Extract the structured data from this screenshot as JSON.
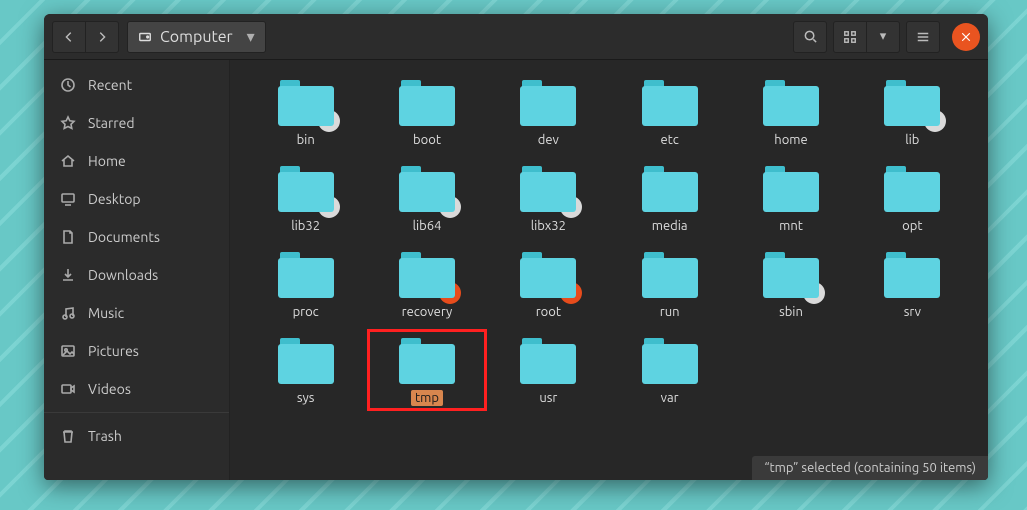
{
  "path": {
    "location": "Computer"
  },
  "sidebar": {
    "items": [
      {
        "label": "Recent",
        "icon": "clock-icon"
      },
      {
        "label": "Starred",
        "icon": "star-icon"
      },
      {
        "label": "Home",
        "icon": "home-icon"
      },
      {
        "label": "Desktop",
        "icon": "desktop-icon"
      },
      {
        "label": "Documents",
        "icon": "documents-icon"
      },
      {
        "label": "Downloads",
        "icon": "downloads-icon"
      },
      {
        "label": "Music",
        "icon": "music-icon"
      },
      {
        "label": "Pictures",
        "icon": "pictures-icon"
      },
      {
        "label": "Videos",
        "icon": "videos-icon"
      },
      {
        "label": "Trash",
        "icon": "trash-icon"
      }
    ]
  },
  "folders": [
    {
      "name": "bin",
      "badge": "link"
    },
    {
      "name": "boot",
      "badge": null
    },
    {
      "name": "dev",
      "badge": null
    },
    {
      "name": "etc",
      "badge": null
    },
    {
      "name": "home",
      "badge": null
    },
    {
      "name": "lib",
      "badge": "link"
    },
    {
      "name": "lib32",
      "badge": "link"
    },
    {
      "name": "lib64",
      "badge": "link"
    },
    {
      "name": "libx32",
      "badge": "link"
    },
    {
      "name": "media",
      "badge": null
    },
    {
      "name": "mnt",
      "badge": null
    },
    {
      "name": "opt",
      "badge": null
    },
    {
      "name": "proc",
      "badge": null
    },
    {
      "name": "recovery",
      "badge": "denied"
    },
    {
      "name": "root",
      "badge": "denied"
    },
    {
      "name": "run",
      "badge": null
    },
    {
      "name": "sbin",
      "badge": "link"
    },
    {
      "name": "srv",
      "badge": null
    },
    {
      "name": "sys",
      "badge": null
    },
    {
      "name": "tmp",
      "badge": null,
      "selected": true,
      "highlight": true
    },
    {
      "name": "usr",
      "badge": null
    },
    {
      "name": "var",
      "badge": null
    }
  ],
  "status": "“tmp” selected  (containing 50 items)"
}
